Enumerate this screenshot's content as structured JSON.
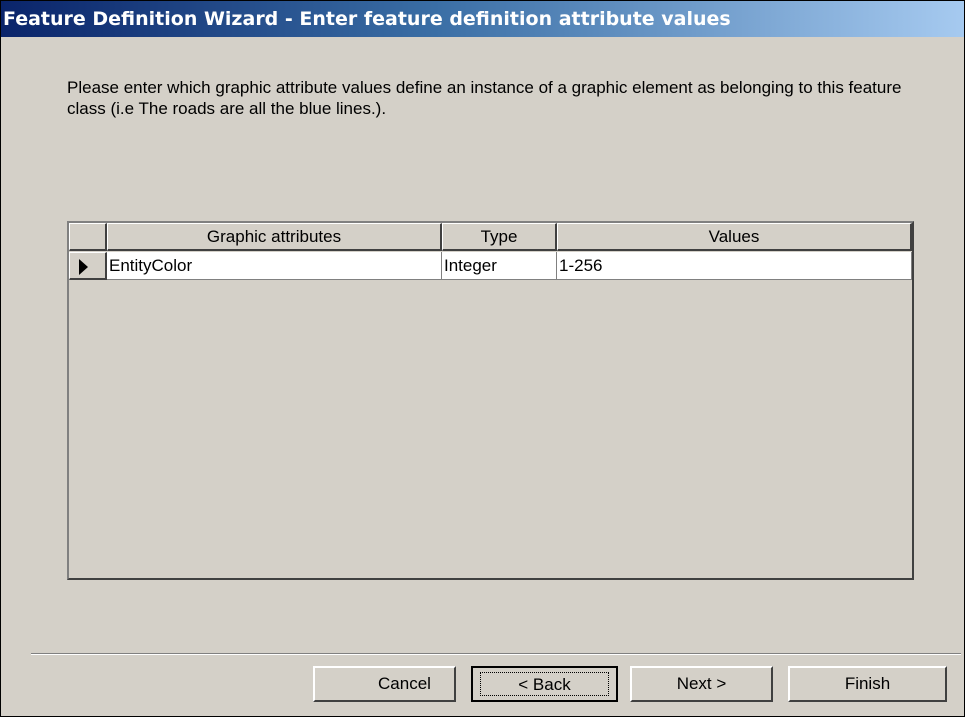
{
  "window": {
    "title": "Feature Definition Wizard - Enter feature definition attribute values"
  },
  "instructions": "Please enter which graphic attribute values define an instance of a graphic element as belonging to this feature class (i.e The roads are all the blue lines.).",
  "grid": {
    "columns": [
      "Graphic attributes",
      "Type",
      "Values"
    ],
    "rows": [
      {
        "attribute": "EntityColor",
        "type": "Integer",
        "values": "1-256",
        "current": true
      }
    ]
  },
  "buttons": {
    "cancel": "Cancel",
    "back": "< Back",
    "next": "Next >",
    "finish": "Finish"
  }
}
